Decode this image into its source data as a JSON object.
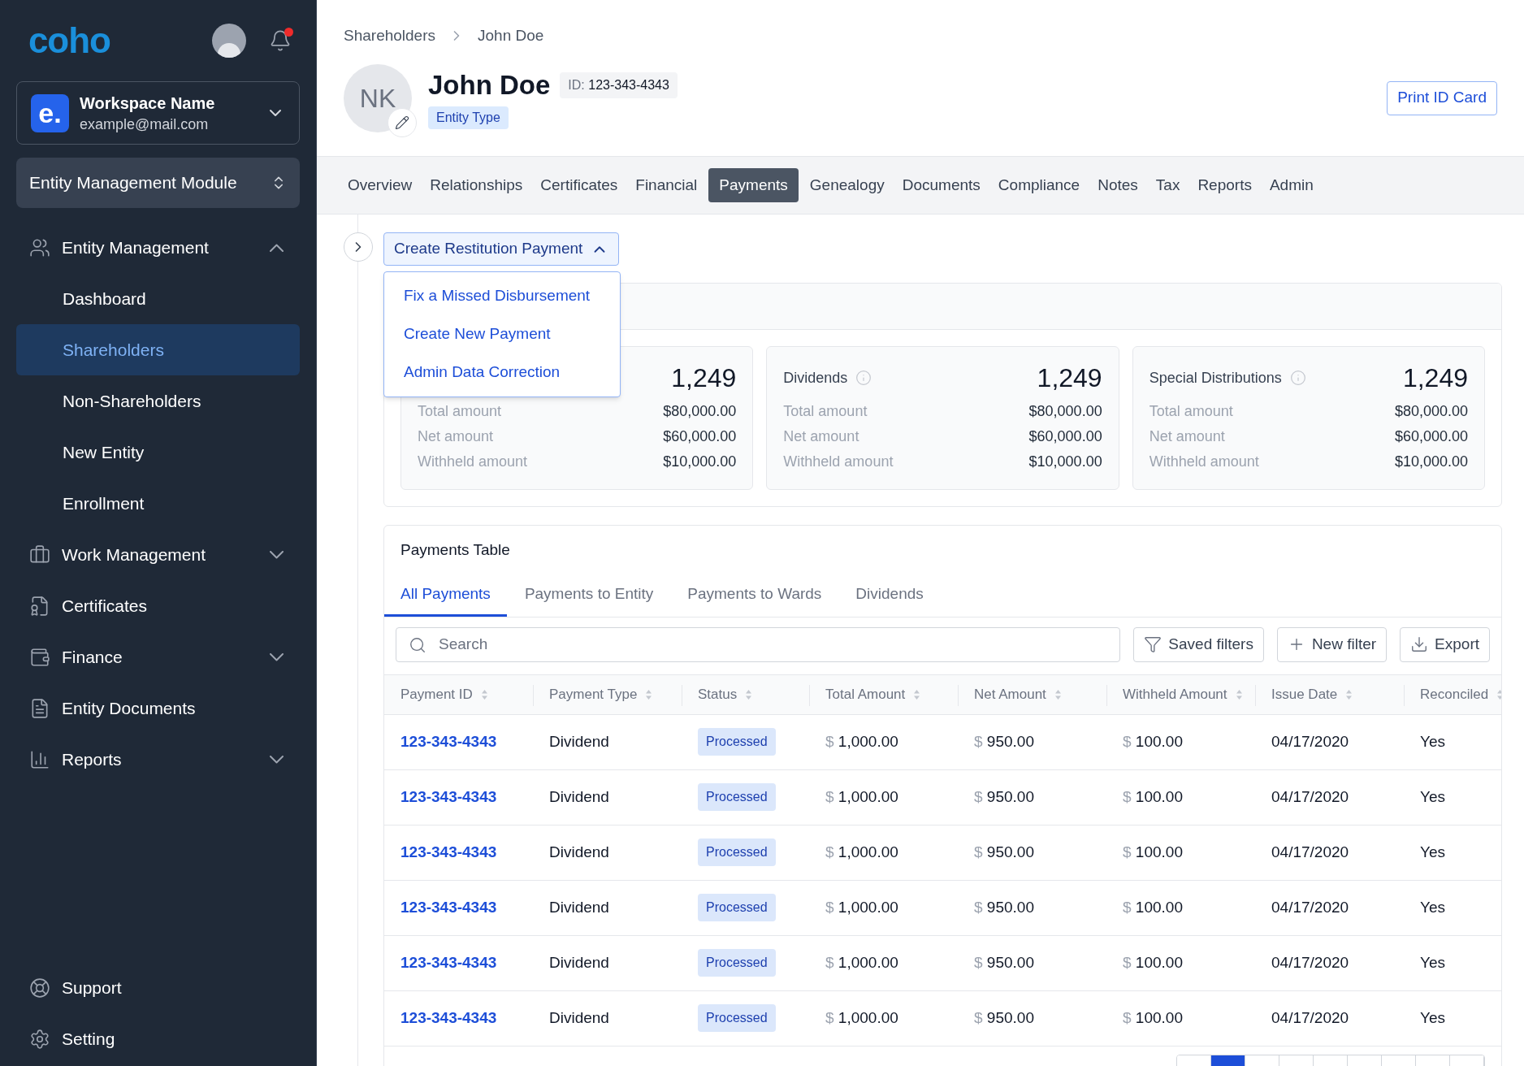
{
  "sidebar": {
    "logo": "coho",
    "notifications": {
      "unread": true
    },
    "workspace": {
      "badge": "e.",
      "name": "Workspace Name",
      "email": "example@mail.com"
    },
    "module": "Entity Management Module",
    "nav": [
      {
        "label": "Entity Management",
        "expanded": true,
        "selected": false,
        "children": [
          {
            "label": "Dashboard",
            "selected": false
          },
          {
            "label": "Shareholders",
            "selected": true
          },
          {
            "label": "Non-Shareholders",
            "selected": false
          },
          {
            "label": "New Entity",
            "selected": false
          },
          {
            "label": "Enrollment",
            "selected": false
          }
        ]
      },
      {
        "label": "Work Management",
        "expanded": false,
        "selected": false
      },
      {
        "label": "Certificates",
        "selected": false
      },
      {
        "label": "Finance",
        "expanded": false,
        "selected": false
      },
      {
        "label": "Entity Documents",
        "selected": false
      },
      {
        "label": "Reports",
        "expanded": false,
        "selected": false
      }
    ],
    "footer": [
      "Support",
      "Setting"
    ]
  },
  "breadcrumb": [
    "Shareholders",
    "John Doe"
  ],
  "profile": {
    "initials": "NK",
    "name": "John Doe",
    "id_label": "ID:",
    "id": "123-343-4343",
    "entity_type": "Entity Type"
  },
  "print_button": "Print ID Card",
  "tabs": [
    {
      "label": "Overview",
      "selected": false
    },
    {
      "label": "Relationships",
      "selected": false
    },
    {
      "label": "Certificates",
      "selected": false
    },
    {
      "label": "Financial",
      "selected": false
    },
    {
      "label": "Payments",
      "selected": true
    },
    {
      "label": "Genealogy",
      "selected": false
    },
    {
      "label": "Documents",
      "selected": false
    },
    {
      "label": "Compliance",
      "selected": false
    },
    {
      "label": "Notes",
      "selected": false
    },
    {
      "label": "Tax",
      "selected": false
    },
    {
      "label": "Reports",
      "selected": false
    },
    {
      "label": "Admin",
      "selected": false
    }
  ],
  "action": {
    "label": "Create Restitution Payment",
    "expanded": true,
    "menu": [
      "Fix a Missed Disbursement",
      "Create New Payment",
      "Admin Data Correction"
    ]
  },
  "summary_cards": [
    {
      "count": "1,249",
      "rows": [
        {
          "label": "Total amount",
          "value": "$80,000.00"
        },
        {
          "label": "Net amount",
          "value": "$60,000.00"
        },
        {
          "label": "Withheld amount",
          "value": "$10,000.00"
        }
      ]
    },
    {
      "title": "Dividends",
      "count": "1,249",
      "rows": [
        {
          "label": "Total amount",
          "value": "$80,000.00"
        },
        {
          "label": "Net amount",
          "value": "$60,000.00"
        },
        {
          "label": "Withheld amount",
          "value": "$10,000.00"
        }
      ]
    },
    {
      "title": "Special Distributions",
      "count": "1,249",
      "rows": [
        {
          "label": "Total amount",
          "value": "$80,000.00"
        },
        {
          "label": "Net amount",
          "value": "$60,000.00"
        },
        {
          "label": "Withheld amount",
          "value": "$10,000.00"
        }
      ]
    }
  ],
  "payments_table": {
    "title": "Payments Table",
    "tabs": [
      {
        "label": "All Payments",
        "selected": true
      },
      {
        "label": "Payments to Entity",
        "selected": false
      },
      {
        "label": "Payments to Wards",
        "selected": false
      },
      {
        "label": "Dividends",
        "selected": false
      }
    ],
    "search": {
      "placeholder": "Search"
    },
    "buttons": [
      "Saved filters",
      "New filter",
      "Export"
    ],
    "columns": [
      "Payment ID",
      "Payment Type",
      "Status",
      "Total Amount",
      "Net Amount",
      "Withheld Amount",
      "Issue Date",
      "Reconciled"
    ],
    "rows": [
      {
        "payment_id": "123-343-4343",
        "payment_type": "Dividend",
        "status": "Processed",
        "total_amount": {
          "currency": "$",
          "amount": "1,000.00"
        },
        "net_amount": {
          "currency": "$",
          "amount": "950.00"
        },
        "withheld_amount": {
          "currency": "$",
          "amount": "100.00"
        },
        "issue_date": "04/17/2020",
        "reconciled": "Yes"
      },
      {
        "payment_id": "123-343-4343",
        "payment_type": "Dividend",
        "status": "Processed",
        "total_amount": {
          "currency": "$",
          "amount": "1,000.00"
        },
        "net_amount": {
          "currency": "$",
          "amount": "950.00"
        },
        "withheld_amount": {
          "currency": "$",
          "amount": "100.00"
        },
        "issue_date": "04/17/2020",
        "reconciled": "Yes"
      },
      {
        "payment_id": "123-343-4343",
        "payment_type": "Dividend",
        "status": "Processed",
        "total_amount": {
          "currency": "$",
          "amount": "1,000.00"
        },
        "net_amount": {
          "currency": "$",
          "amount": "950.00"
        },
        "withheld_amount": {
          "currency": "$",
          "amount": "100.00"
        },
        "issue_date": "04/17/2020",
        "reconciled": "Yes"
      },
      {
        "payment_id": "123-343-4343",
        "payment_type": "Dividend",
        "status": "Processed",
        "total_amount": {
          "currency": "$",
          "amount": "1,000.00"
        },
        "net_amount": {
          "currency": "$",
          "amount": "950.00"
        },
        "withheld_amount": {
          "currency": "$",
          "amount": "100.00"
        },
        "issue_date": "04/17/2020",
        "reconciled": "Yes"
      },
      {
        "payment_id": "123-343-4343",
        "payment_type": "Dividend",
        "status": "Processed",
        "total_amount": {
          "currency": "$",
          "amount": "1,000.00"
        },
        "net_amount": {
          "currency": "$",
          "amount": "950.00"
        },
        "withheld_amount": {
          "currency": "$",
          "amount": "100.00"
        },
        "issue_date": "04/17/2020",
        "reconciled": "Yes"
      },
      {
        "payment_id": "123-343-4343",
        "payment_type": "Dividend",
        "status": "Processed",
        "total_amount": {
          "currency": "$",
          "amount": "1,000.00"
        },
        "net_amount": {
          "currency": "$",
          "amount": "950.00"
        },
        "withheld_amount": {
          "currency": "$",
          "amount": "100.00"
        },
        "issue_date": "04/17/2020",
        "reconciled": "Yes"
      }
    ],
    "pagination": [
      {
        "selected": false
      },
      {
        "selected": true
      },
      {
        "selected": false
      },
      {
        "selected": false
      },
      {
        "selected": false
      },
      {
        "selected": false
      },
      {
        "selected": false
      },
      {
        "selected": false
      },
      {
        "selected": false
      }
    ]
  }
}
